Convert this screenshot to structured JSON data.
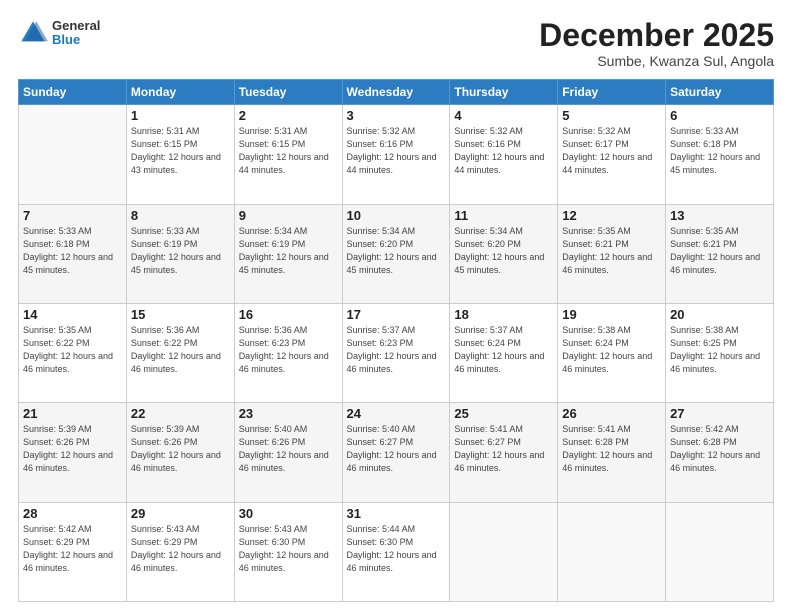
{
  "header": {
    "logo_general": "General",
    "logo_blue": "Blue",
    "month_title": "December 2025",
    "location": "Sumbe, Kwanza Sul, Angola"
  },
  "weekdays": [
    "Sunday",
    "Monday",
    "Tuesday",
    "Wednesday",
    "Thursday",
    "Friday",
    "Saturday"
  ],
  "weeks": [
    [
      {
        "day": "",
        "sunrise": "",
        "sunset": "",
        "daylight": ""
      },
      {
        "day": "1",
        "sunrise": "5:31 AM",
        "sunset": "6:15 PM",
        "daylight": "12 hours and 43 minutes."
      },
      {
        "day": "2",
        "sunrise": "5:31 AM",
        "sunset": "6:15 PM",
        "daylight": "12 hours and 44 minutes."
      },
      {
        "day": "3",
        "sunrise": "5:32 AM",
        "sunset": "6:16 PM",
        "daylight": "12 hours and 44 minutes."
      },
      {
        "day": "4",
        "sunrise": "5:32 AM",
        "sunset": "6:16 PM",
        "daylight": "12 hours and 44 minutes."
      },
      {
        "day": "5",
        "sunrise": "5:32 AM",
        "sunset": "6:17 PM",
        "daylight": "12 hours and 44 minutes."
      },
      {
        "day": "6",
        "sunrise": "5:33 AM",
        "sunset": "6:18 PM",
        "daylight": "12 hours and 45 minutes."
      }
    ],
    [
      {
        "day": "7",
        "sunrise": "5:33 AM",
        "sunset": "6:18 PM",
        "daylight": "12 hours and 45 minutes."
      },
      {
        "day": "8",
        "sunrise": "5:33 AM",
        "sunset": "6:19 PM",
        "daylight": "12 hours and 45 minutes."
      },
      {
        "day": "9",
        "sunrise": "5:34 AM",
        "sunset": "6:19 PM",
        "daylight": "12 hours and 45 minutes."
      },
      {
        "day": "10",
        "sunrise": "5:34 AM",
        "sunset": "6:20 PM",
        "daylight": "12 hours and 45 minutes."
      },
      {
        "day": "11",
        "sunrise": "5:34 AM",
        "sunset": "6:20 PM",
        "daylight": "12 hours and 45 minutes."
      },
      {
        "day": "12",
        "sunrise": "5:35 AM",
        "sunset": "6:21 PM",
        "daylight": "12 hours and 46 minutes."
      },
      {
        "day": "13",
        "sunrise": "5:35 AM",
        "sunset": "6:21 PM",
        "daylight": "12 hours and 46 minutes."
      }
    ],
    [
      {
        "day": "14",
        "sunrise": "5:35 AM",
        "sunset": "6:22 PM",
        "daylight": "12 hours and 46 minutes."
      },
      {
        "day": "15",
        "sunrise": "5:36 AM",
        "sunset": "6:22 PM",
        "daylight": "12 hours and 46 minutes."
      },
      {
        "day": "16",
        "sunrise": "5:36 AM",
        "sunset": "6:23 PM",
        "daylight": "12 hours and 46 minutes."
      },
      {
        "day": "17",
        "sunrise": "5:37 AM",
        "sunset": "6:23 PM",
        "daylight": "12 hours and 46 minutes."
      },
      {
        "day": "18",
        "sunrise": "5:37 AM",
        "sunset": "6:24 PM",
        "daylight": "12 hours and 46 minutes."
      },
      {
        "day": "19",
        "sunrise": "5:38 AM",
        "sunset": "6:24 PM",
        "daylight": "12 hours and 46 minutes."
      },
      {
        "day": "20",
        "sunrise": "5:38 AM",
        "sunset": "6:25 PM",
        "daylight": "12 hours and 46 minutes."
      }
    ],
    [
      {
        "day": "21",
        "sunrise": "5:39 AM",
        "sunset": "6:26 PM",
        "daylight": "12 hours and 46 minutes."
      },
      {
        "day": "22",
        "sunrise": "5:39 AM",
        "sunset": "6:26 PM",
        "daylight": "12 hours and 46 minutes."
      },
      {
        "day": "23",
        "sunrise": "5:40 AM",
        "sunset": "6:26 PM",
        "daylight": "12 hours and 46 minutes."
      },
      {
        "day": "24",
        "sunrise": "5:40 AM",
        "sunset": "6:27 PM",
        "daylight": "12 hours and 46 minutes."
      },
      {
        "day": "25",
        "sunrise": "5:41 AM",
        "sunset": "6:27 PM",
        "daylight": "12 hours and 46 minutes."
      },
      {
        "day": "26",
        "sunrise": "5:41 AM",
        "sunset": "6:28 PM",
        "daylight": "12 hours and 46 minutes."
      },
      {
        "day": "27",
        "sunrise": "5:42 AM",
        "sunset": "6:28 PM",
        "daylight": "12 hours and 46 minutes."
      }
    ],
    [
      {
        "day": "28",
        "sunrise": "5:42 AM",
        "sunset": "6:29 PM",
        "daylight": "12 hours and 46 minutes."
      },
      {
        "day": "29",
        "sunrise": "5:43 AM",
        "sunset": "6:29 PM",
        "daylight": "12 hours and 46 minutes."
      },
      {
        "day": "30",
        "sunrise": "5:43 AM",
        "sunset": "6:30 PM",
        "daylight": "12 hours and 46 minutes."
      },
      {
        "day": "31",
        "sunrise": "5:44 AM",
        "sunset": "6:30 PM",
        "daylight": "12 hours and 46 minutes."
      },
      {
        "day": "",
        "sunrise": "",
        "sunset": "",
        "daylight": ""
      },
      {
        "day": "",
        "sunrise": "",
        "sunset": "",
        "daylight": ""
      },
      {
        "day": "",
        "sunrise": "",
        "sunset": "",
        "daylight": ""
      }
    ]
  ]
}
